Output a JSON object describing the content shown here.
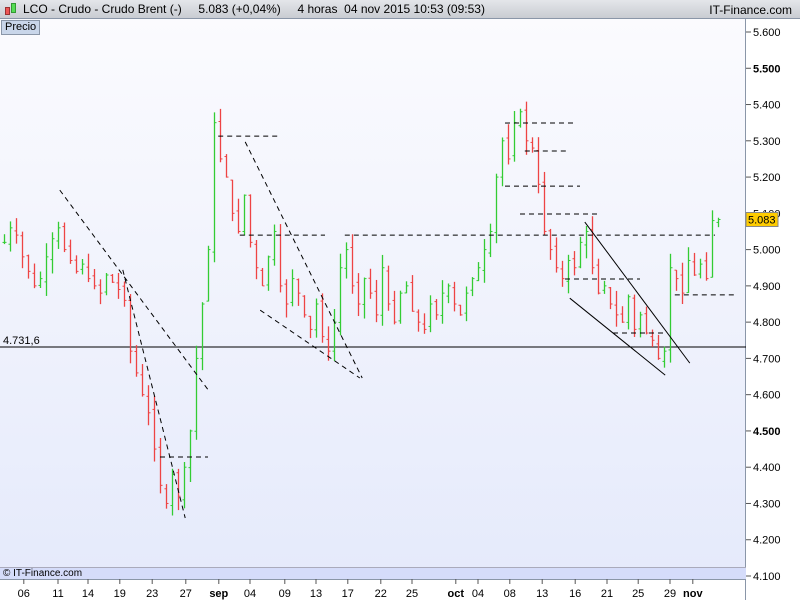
{
  "header": {
    "symbol": "LCO - Crudo - Crudo Brent (-)",
    "price": "5.083 (+0,04%)",
    "interval": "4 horas",
    "datetime": "04 nov 2015 10:53 (09:53)",
    "site": "IT-Finance.com"
  },
  "panel_label": "Precio",
  "footer": "© IT-Finance.com",
  "colors": {
    "up": "#33cc33",
    "down": "#ee4444",
    "badge": "#ffcc00"
  },
  "chart_data": {
    "type": "ohlc",
    "title": "LCO - Crudo - Crudo Brent (-)",
    "ylim": [
      4.1,
      5.6
    ],
    "yticks": [
      "5.600",
      "5.500",
      "5.400",
      "5.300",
      "5.200",
      "5.100",
      "5.000",
      "4.900",
      "4.800",
      "4.700",
      "4.600",
      "4.500",
      "4.400",
      "4.300",
      "4.200",
      "4.100"
    ],
    "ytick_values": [
      5.6,
      5.5,
      5.4,
      5.3,
      5.2,
      5.1,
      5.0,
      4.9,
      4.8,
      4.7,
      4.6,
      4.5,
      4.4,
      4.3,
      4.2,
      4.1
    ],
    "xticks": [
      {
        "label": "06",
        "i": 3.3
      },
      {
        "label": "11",
        "i": 9
      },
      {
        "label": "14",
        "i": 14
      },
      {
        "label": "19",
        "i": 19.3
      },
      {
        "label": "23",
        "i": 24.7
      },
      {
        "label": "27",
        "i": 30.3
      },
      {
        "label": "sep",
        "i": 35.8,
        "bold": true
      },
      {
        "label": "04",
        "i": 41
      },
      {
        "label": "09",
        "i": 46.8
      },
      {
        "label": "13",
        "i": 52
      },
      {
        "label": "17",
        "i": 57.3
      },
      {
        "label": "22",
        "i": 62.8
      },
      {
        "label": "25",
        "i": 68
      },
      {
        "label": "oct",
        "i": 75.3,
        "bold": true
      },
      {
        "label": "04",
        "i": 79
      },
      {
        "label": "08",
        "i": 84.3
      },
      {
        "label": "13",
        "i": 89.7
      },
      {
        "label": "16",
        "i": 95.2
      },
      {
        "label": "21",
        "i": 100.5
      },
      {
        "label": "25",
        "i": 105.7
      },
      {
        "label": "29",
        "i": 111
      },
      {
        "label": "nov",
        "i": 114.8,
        "bold": true
      }
    ],
    "closes": [
      5.02,
      5.06,
      5.04,
      4.98,
      4.94,
      4.9,
      4.92,
      4.98,
      5.03,
      5.06,
      5.0,
      4.97,
      4.94,
      4.96,
      4.92,
      4.9,
      4.88,
      4.93,
      4.91,
      4.89,
      4.86,
      4.72,
      4.66,
      4.6,
      4.55,
      4.45,
      4.35,
      4.3,
      4.38,
      4.32,
      4.4,
      4.5,
      4.7,
      4.85,
      5.0,
      5.35,
      5.25,
      5.2,
      5.1,
      5.05,
      5.15,
      5.02,
      4.95,
      4.9,
      4.98,
      5.05,
      4.9,
      4.85,
      4.92,
      4.88,
      4.82,
      4.78,
      4.85,
      4.76,
      4.72,
      4.8,
      4.95,
      5.0,
      4.9,
      4.85,
      4.92,
      4.88,
      4.82,
      4.95,
      4.85,
      4.8,
      4.88,
      4.9,
      4.83,
      4.8,
      4.78,
      4.85,
      4.82,
      4.88,
      4.9,
      4.85,
      4.82,
      4.88,
      4.92,
      4.95,
      5.0,
      5.05,
      5.2,
      5.3,
      5.25,
      5.35,
      5.38,
      5.3,
      5.28,
      5.18,
      5.05,
      5.0,
      4.95,
      4.92,
      4.97,
      4.95,
      5.02,
      5.05,
      4.95,
      4.88,
      4.9,
      4.85,
      4.82,
      4.8,
      4.87,
      4.78,
      4.82,
      4.77,
      4.75,
      4.7,
      4.72,
      4.95,
      4.92,
      4.88,
      4.97,
      4.93,
      4.96,
      4.92,
      5.08,
      5.083
    ],
    "last_price_label": "5.083",
    "reference_line": {
      "price": 4.7316,
      "label": "4.731,6"
    },
    "trendlines": [
      {
        "style": "dashed",
        "from": [
          9.3,
          5.164
        ],
        "to": [
          34.3,
          4.607
        ]
      },
      {
        "style": "dashed",
        "from": [
          19.8,
          4.944
        ],
        "to": [
          30.2,
          4.26
        ]
      },
      {
        "style": "dashed",
        "from": [
          35.7,
          5.313
        ],
        "to": [
          45.7,
          5.313
        ]
      },
      {
        "style": "dashed",
        "from": [
          40.2,
          5.297
        ],
        "to": [
          59.7,
          4.646
        ]
      },
      {
        "style": "dashed",
        "from": [
          39.3,
          5.04
        ],
        "to": [
          53.5,
          5.04
        ]
      },
      {
        "style": "dashed",
        "from": [
          42.7,
          4.833
        ],
        "to": [
          59.3,
          4.646
        ]
      },
      {
        "style": "dashed",
        "from": [
          26,
          4.428
        ],
        "to": [
          34,
          4.428
        ]
      },
      {
        "style": "dashed",
        "from": [
          56.8,
          5.04
        ],
        "to": [
          118.5,
          5.04
        ]
      },
      {
        "style": "dashed",
        "from": [
          83.5,
          5.349
        ],
        "to": [
          95.2,
          5.349
        ]
      },
      {
        "style": "dashed",
        "from": [
          86.8,
          5.272
        ],
        "to": [
          94.3,
          5.272
        ]
      },
      {
        "style": "dashed",
        "from": [
          83.5,
          5.175
        ],
        "to": [
          96,
          5.175
        ]
      },
      {
        "style": "dashed",
        "from": [
          86,
          5.098
        ],
        "to": [
          99.3,
          5.098
        ]
      },
      {
        "style": "dashed",
        "from": [
          93.5,
          4.919
        ],
        "to": [
          106,
          4.919
        ]
      },
      {
        "style": "dashed",
        "from": [
          101.5,
          4.77
        ],
        "to": [
          110.2,
          4.77
        ]
      },
      {
        "style": "dashed",
        "from": [
          111.8,
          4.875
        ],
        "to": [
          121.8,
          4.875
        ]
      },
      {
        "style": "solid",
        "from": [
          94.3,
          4.866
        ],
        "to": [
          110.2,
          4.654
        ]
      },
      {
        "style": "solid",
        "from": [
          96.8,
          5.076
        ],
        "to": [
          114.3,
          4.687
        ]
      }
    ]
  }
}
